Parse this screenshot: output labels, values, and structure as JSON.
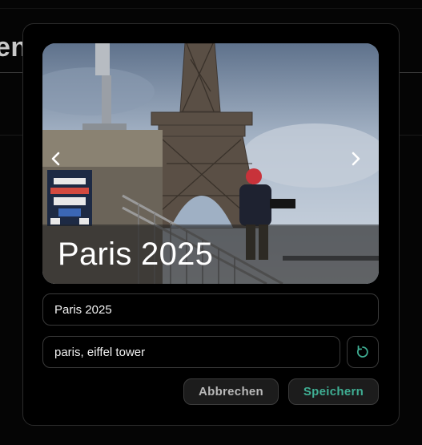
{
  "background": {
    "title_fragment": "en"
  },
  "modal": {
    "carousel": {
      "caption": "Paris 2025",
      "image_alt": "Eiffel Tower with person photographing on stairs",
      "prev_icon": "chevron-left-icon",
      "next_icon": "chevron-right-icon"
    },
    "title_input": {
      "value": "Paris 2025"
    },
    "tags_input": {
      "value": "paris, eiffel tower"
    },
    "refresh_icon": "refresh-icon",
    "buttons": {
      "cancel_label": "Abbrechen",
      "save_label": "Speichern"
    }
  },
  "colors": {
    "accent": "#3fae93",
    "background": "#000000",
    "border": "#3a3a3a"
  }
}
